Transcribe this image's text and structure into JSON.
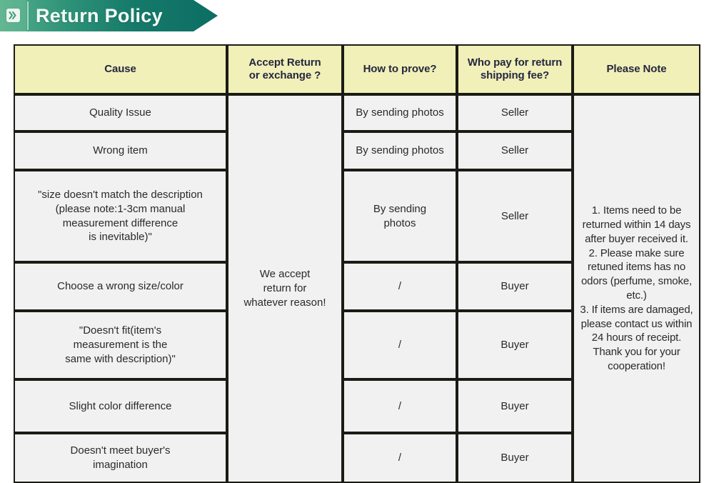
{
  "banner": {
    "title": "Return Policy",
    "icon": "chevron-double-right-icon",
    "gradient_start": "#5bb08c",
    "gradient_end": "#0c6e63"
  },
  "table": {
    "header_bg": "#f0f0b8",
    "cell_bg": "#f1f1f1",
    "border_color": "#1b1b16",
    "columns": [
      "Cause",
      "Accept Return\nor exchange ?",
      "How to prove?",
      "Who pay for return\nshipping fee?",
      "Please Note"
    ],
    "accept_merged_value": "We accept\nreturn for\nwhatever reason!",
    "please_note_value": "1. Items need to be returned within 14 days after buyer received it.\n2. Please make sure retuned items has no odors (perfume, smoke, etc.)\n3. If items are damaged, please contact us within 24 hours of receipt.\nThank you for your cooperation!",
    "rows": [
      {
        "cause": "Quality Issue",
        "how_to_prove": "By sending photos",
        "who_pays": "Seller"
      },
      {
        "cause": "Wrong item",
        "how_to_prove": "By sending photos",
        "who_pays": "Seller"
      },
      {
        "cause": "\"size doesn't match the description\n(please note:1-3cm manual\nmeasurement difference\nis inevitable)\"",
        "how_to_prove": "By sending\nphotos",
        "who_pays": "Seller"
      },
      {
        "cause": "Choose a wrong size/color",
        "how_to_prove": "/",
        "who_pays": "Buyer"
      },
      {
        "cause": "\"Doesn't fit(item's\nmeasurement is the\nsame with description)\"",
        "how_to_prove": "/",
        "who_pays": "Buyer"
      },
      {
        "cause": "Slight color difference",
        "how_to_prove": "/",
        "who_pays": "Buyer"
      },
      {
        "cause": "Doesn't meet buyer's\nimagination",
        "how_to_prove": "/",
        "who_pays": "Buyer"
      }
    ]
  }
}
